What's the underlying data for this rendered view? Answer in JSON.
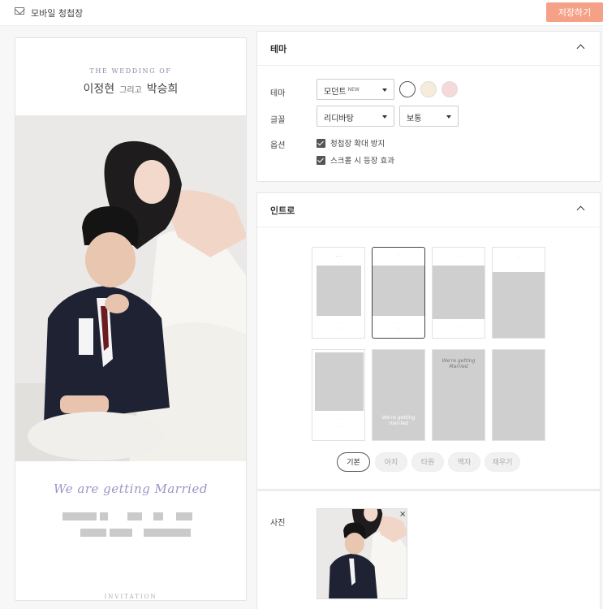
{
  "header": {
    "title": "모바일 청첩장",
    "save_label": "저장하기"
  },
  "preview": {
    "wedding_of": "THE WEDDING OF",
    "groom": "이정현",
    "connector": "그리고",
    "bride": "박승희",
    "script": "We are getting Married",
    "invitation": "INVITATION"
  },
  "theme_section": {
    "title": "테마",
    "theme_label": "테마",
    "theme_value": "모던트",
    "theme_badge": "NEW",
    "swatches": [
      "#ffffff",
      "#f6ecd9",
      "#f6d9d9"
    ],
    "font_label": "글꼴",
    "font_value": "리디바탕",
    "weight_value": "보통",
    "option_label": "옵션",
    "options": [
      "청첩장 확대 방지",
      "스크롤 시 등장 효과"
    ]
  },
  "intro_section": {
    "title": "인트로",
    "tabs": [
      "기본",
      "아치",
      "타원",
      "액자",
      "채우기"
    ],
    "tpl_script_a": "We're getting Married",
    "tpl_script_b": "We're getting married"
  },
  "photo_section": {
    "label": "사진",
    "close": "×"
  }
}
